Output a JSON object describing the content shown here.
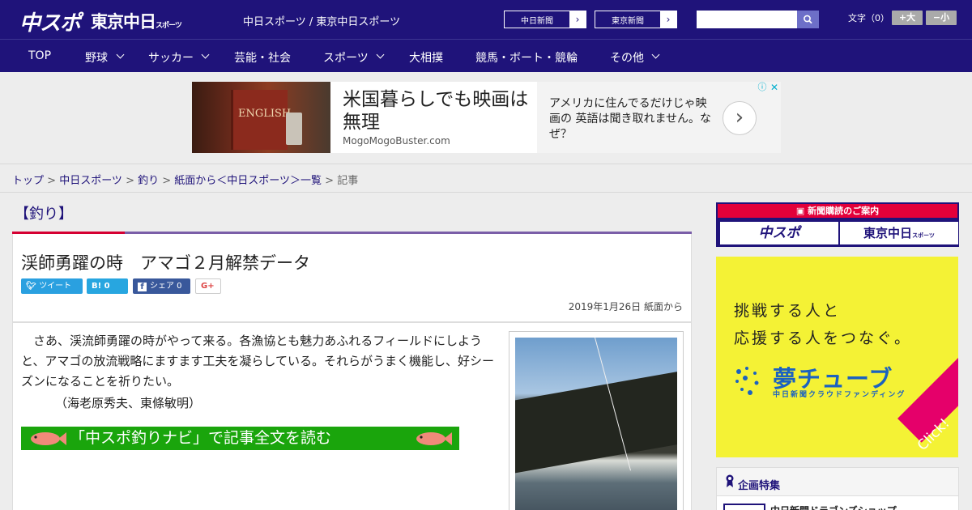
{
  "header": {
    "logo_main": "中スポ",
    "logo_tokyo": "東京中日",
    "logo_tokyo_small": "スポーツ",
    "site_name": "中日スポーツ / 東京中日スポーツ",
    "chunichi_button": "中日新聞",
    "tokyo_button": "東京新聞",
    "arrow": "›",
    "search_placeholder": "",
    "font_size_label": "文字（0）",
    "font_plus": "+大",
    "font_minus": "−小"
  },
  "nav": {
    "items": [
      {
        "label": "TOP",
        "has_menu": false
      },
      {
        "label": "野球",
        "has_menu": true
      },
      {
        "label": "サッカー",
        "has_menu": true
      },
      {
        "label": "芸能・社会",
        "has_menu": false
      },
      {
        "label": "スポーツ",
        "has_menu": true
      },
      {
        "label": "大相撲",
        "has_menu": false
      },
      {
        "label": "競馬・ボート・競輪",
        "has_menu": false
      },
      {
        "label": "その他",
        "has_menu": true
      }
    ]
  },
  "ad": {
    "image_text": "ENGLISH",
    "headline": "米国暮らしでも映画は無理",
    "domain": "MogoMogoBuster.com",
    "body": "アメリカに住んでるだけじゃ映画の 英語は聞き取れません。なぜ？",
    "next_arrow": "›",
    "info_icon": "ⓘ",
    "close_icon": "✕"
  },
  "breadcrumb": {
    "items": [
      "トップ",
      "中日スポーツ",
      "釣り",
      "紙面から＜中日スポーツ＞一覧"
    ],
    "separator": " > ",
    "current": "記事"
  },
  "article": {
    "category": "【釣り】",
    "title": "渓師勇躍の時　アマゴ２月解禁データ",
    "share": {
      "tweet": "ツイート",
      "hatena": "B! 0",
      "facebook": "シェア 0",
      "gplus": "G+"
    },
    "date": "2019年1月26日 紙面から",
    "lead": "　さあ、渓流師勇躍の時がやって来る。各漁協とも魅力あふれるフィールドにしようと、アマゴの放流戦略にますます工夫を凝らしている。それらがうまく機能し、好シーズンになることを祈りたい。",
    "byline": "（海老原秀夫、東條敏明）",
    "readmore": "「中スポ釣りナビ」で記事全文を読む"
  },
  "sidebar": {
    "subscription": {
      "heading": "新聞購読のご案内",
      "chuspo": "中スポ",
      "tokyo": "東京中日",
      "tokyo_small": "スポーツ"
    },
    "yume": {
      "line1": "挑戦する人と",
      "line2": "応援する人をつなぐ。",
      "logo": "夢チューブ",
      "sub": "中日新聞クラウドファンディング",
      "click": "Click!"
    },
    "feature": {
      "title": "企画特集",
      "item": "中日新聞ドラゴンズショップ"
    }
  },
  "colors": {
    "brand_navy": "#1f137a",
    "accent_red": "#d50032",
    "readmore_green": "#1aa50c",
    "yume_yellow": "#f4f235",
    "yume_blue": "#1b62c0",
    "click_pink": "#e5006a"
  }
}
